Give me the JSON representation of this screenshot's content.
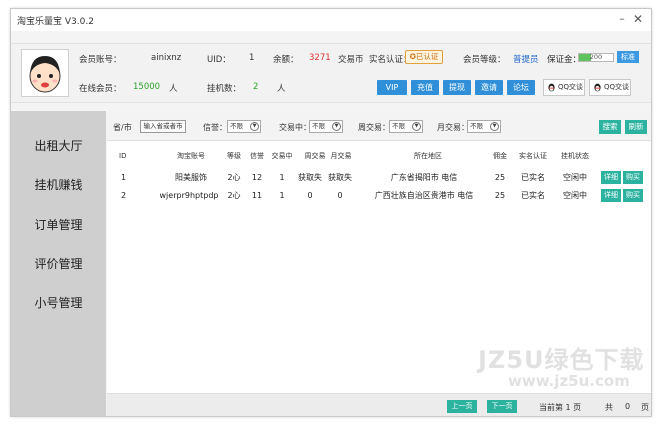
{
  "window": {
    "title": "淘宝乐量宝 V3.0.2",
    "min_icon": "minimize-icon",
    "close_icon": "close-icon"
  },
  "header": {
    "member_account_label": "会员账号：",
    "member_account_value": "ainixnz",
    "uid_label": "UID：",
    "uid_value": "1",
    "balance_label": "余额：",
    "balance_value": "3271",
    "currency_label": "交易币",
    "real_name_label": "实名认证：",
    "real_name_button": "已认证",
    "member_level_label": "会员等级：",
    "member_level_value": "普提员",
    "deposit_label": "保证金：",
    "deposit_progress": "200",
    "deposit_fill_fraction": 0.35,
    "deposit_button": "标准",
    "online_label": "在线会员：",
    "online_value": "15000",
    "online_unit": "人",
    "hang_label": "挂机数：",
    "hang_value": "2",
    "hang_unit": "人",
    "actions": [
      "VIP",
      "充值",
      "提现",
      "邀请",
      "论坛"
    ],
    "qq_buttons": [
      "QQ交谈",
      "QQ交谈"
    ]
  },
  "sidebar": {
    "items": [
      "出租大厅",
      "挂机赚钱",
      "订单管理",
      "评价管理",
      "小号管理"
    ]
  },
  "filters": {
    "region_label": "省/市",
    "region_button": "输入省或者市",
    "credit_label": "信誉：",
    "credit_value": "不限",
    "trading_label": "交易中：",
    "trading_value": "不限",
    "weekly_label": "周交易：",
    "weekly_value": "不限",
    "monthly_label": "月交易：",
    "monthly_value": "不限",
    "search_button": "搜索",
    "refresh_button": "刷新"
  },
  "table": {
    "headers": [
      "ID",
      "淘宝账号",
      "等级",
      "信誉",
      "交易中",
      "周交易",
      "月交易",
      "所在地区",
      "佣金",
      "实名认证",
      "挂机状态"
    ],
    "rows": [
      [
        "1",
        "阳美服饰",
        "2心",
        "12",
        "1",
        "获取失",
        "获取失",
        "广东省揭阳市 电信",
        "25",
        "已实名",
        "空闲中"
      ],
      [
        "2",
        "wjerpr9hptpdp",
        "2心",
        "11",
        "1",
        "0",
        "0",
        "广西壮族自治区贵港市 电信",
        "25",
        "已实名",
        "空闲中"
      ]
    ],
    "detail_button": "详细",
    "buy_button": "购买"
  },
  "footer": {
    "prev_button": "上一页",
    "next_button": "下一页",
    "current_page": "当前第 1 页",
    "total_label": "共",
    "total_value": "0",
    "page_unit": "页"
  },
  "watermark": {
    "main": "JZ5U绿色下载",
    "sub": "www.jz5u.com"
  },
  "colors": {
    "accent_blue": "#2f8fd8",
    "teal": "#2bb3a0",
    "balance_red": "#e03030",
    "online_green": "#2ea02e",
    "level_blue": "#2266cc"
  }
}
